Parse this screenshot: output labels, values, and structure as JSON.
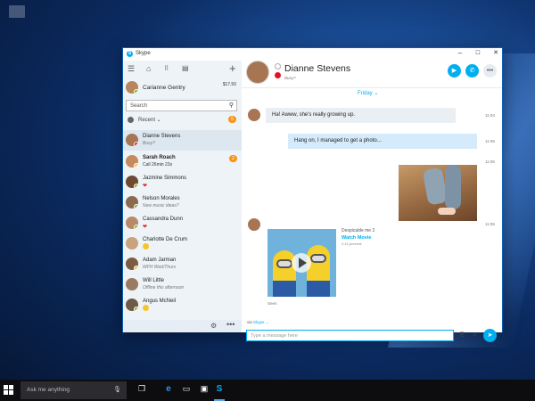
{
  "window": {
    "title": "Skype",
    "logo": "S"
  },
  "window_controls": {
    "minimize": "–",
    "maximize": "☐",
    "close": "✕"
  },
  "sidebar": {
    "me": {
      "name": "Carianne Gentry",
      "credit": "$17.50"
    },
    "search": {
      "placeholder": "Search"
    },
    "recent": {
      "label": "Recent ⌄",
      "badge": "5"
    },
    "contacts": [
      {
        "name": "Dianne Stevens",
        "sub": "Busy?",
        "status": "busy"
      },
      {
        "name": "Sarah Roach",
        "sub": "Call 26min 23s",
        "badge": "2",
        "status": "away"
      },
      {
        "name": "Jazmine Simmons",
        "sub": "❤",
        "status": "online"
      },
      {
        "name": "Nelson Morales",
        "sub": "New music ideas?",
        "status": "online"
      },
      {
        "name": "Cassandra Dunn",
        "sub": "❤",
        "status": "online"
      },
      {
        "name": "Charlotte De Crum",
        "sub": "",
        "status": "none"
      },
      {
        "name": "Adam Jarman",
        "sub": "WFH Wed/Thurs",
        "status": "away"
      },
      {
        "name": "Will Little",
        "sub": "Offline this afternoon",
        "status": "none"
      },
      {
        "name": "Angus McNeil",
        "sub": "",
        "status": "online"
      }
    ],
    "footer": {
      "gear": "⚙",
      "more": "•••"
    }
  },
  "chat": {
    "contact": {
      "name": "Dianne Stevens",
      "status": "Busy?"
    },
    "day": "Friday ⌄",
    "messages": [
      {
        "text": "Ha! Awww, she's really growing up.",
        "time": "11:04"
      },
      {
        "text": "Hang on, I managed to get a photo...",
        "time": "11:05"
      },
      {
        "text": "",
        "time": "11:05"
      },
      {
        "text": "",
        "time": "11:06"
      }
    ],
    "media": {
      "title": "Despicable me 2",
      "link": "Watch Movie",
      "sub": "2:15 preview"
    },
    "seen": "Seen",
    "via_prefix": "via ",
    "via_link": "Skype ⌄",
    "composer_placeholder": "Type a message here"
  },
  "taskbar": {
    "search_placeholder": "Ask me anything"
  },
  "colors": {
    "accent": "#00aff0",
    "busy": "#e81123",
    "online": "#7fba00",
    "badge": "#f7941d"
  }
}
